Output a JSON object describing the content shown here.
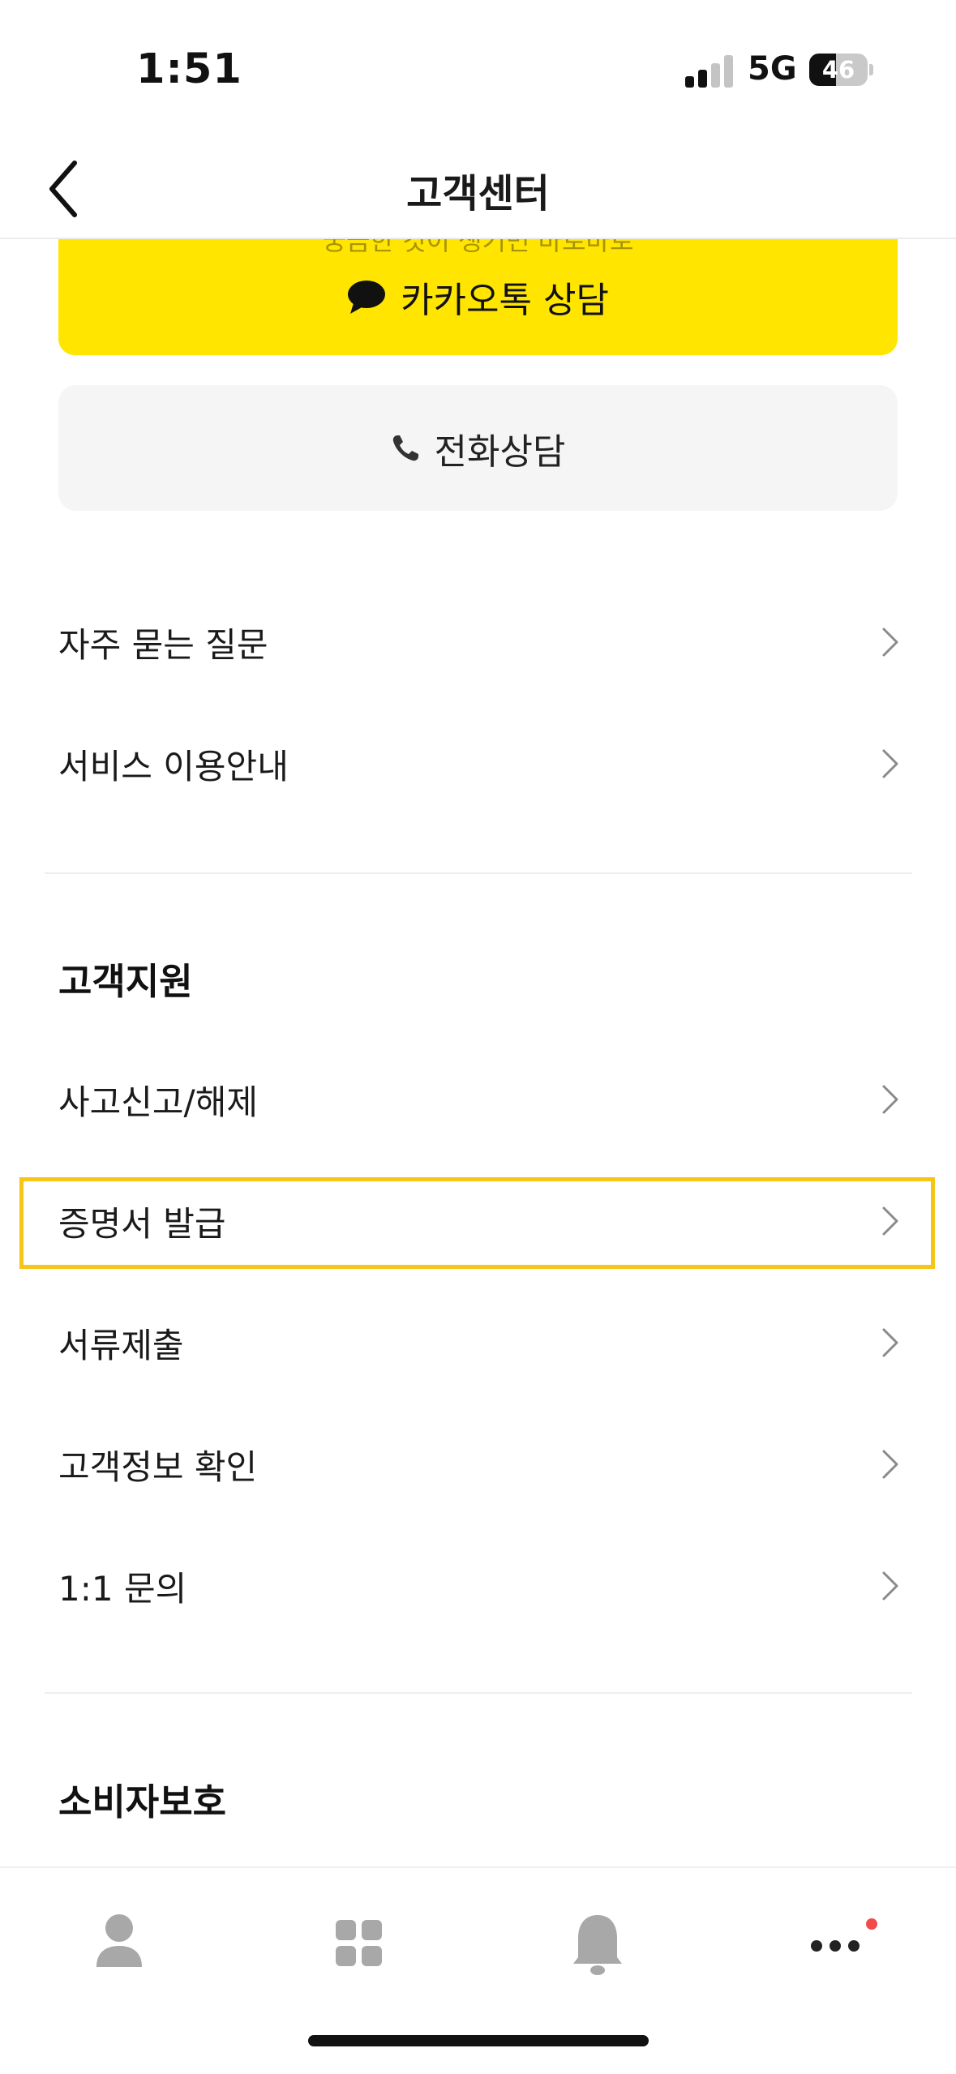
{
  "status_bar": {
    "time": "1:51",
    "network": "5G",
    "battery_percent": "46",
    "battery_level": 0.46
  },
  "header": {
    "title": "고객센터",
    "back_icon": "chevron-left-icon"
  },
  "contact": {
    "kakao_subtext": "궁금한 것이 생기면 바로바로",
    "kakao_label": "카카오톡 상담",
    "kakao_icon": "speech-bubble-icon",
    "phone_label": "전화상담",
    "phone_icon": "phone-icon",
    "accent_color": "#ffe500"
  },
  "general_list": {
    "items": [
      {
        "label": "자주 묻는 질문"
      },
      {
        "label": "서비스 이용안내"
      }
    ]
  },
  "customer_support": {
    "title": "고객지원",
    "items": [
      {
        "label": "사고신고/해제"
      },
      {
        "label": "증명서 발급",
        "highlighted": true
      },
      {
        "label": "서류제출"
      },
      {
        "label": "고객정보 확인"
      },
      {
        "label": "1:1 문의"
      }
    ]
  },
  "consumer_protection": {
    "title": "소비자보호"
  },
  "bottom_nav": {
    "tabs": [
      {
        "icon": "person-icon"
      },
      {
        "icon": "grid-icon"
      },
      {
        "icon": "bell-icon"
      },
      {
        "icon": "more-dots-icon",
        "has_badge": true
      }
    ],
    "badge_color": "#f24b4b"
  }
}
